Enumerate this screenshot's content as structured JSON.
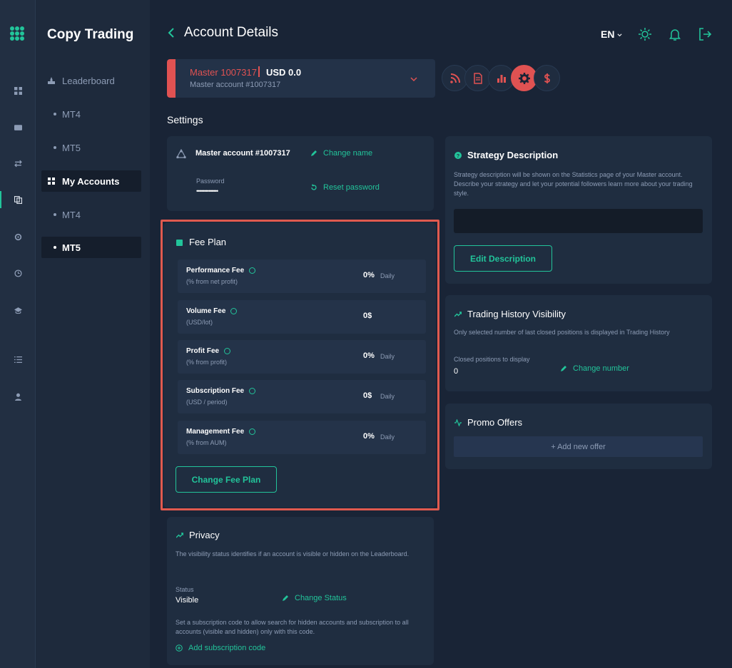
{
  "app": {
    "brand": "Copy Trading"
  },
  "header": {
    "title": "Account Details",
    "language": "EN"
  },
  "sidebar": {
    "items": [
      {
        "label": "Leaderboard"
      },
      {
        "label": "MT4"
      },
      {
        "label": "MT5"
      },
      {
        "label": "My Accounts"
      },
      {
        "label": "MT4"
      },
      {
        "label": "MT5"
      }
    ]
  },
  "account": {
    "name": "Master 1007317",
    "balance": "USD 0.0",
    "subtitle": "Master account #1007317"
  },
  "settings": {
    "label": "Settings",
    "account_card": {
      "name": "Master account #1007317",
      "change_name": "Change name",
      "password_label": "Password",
      "password_mask": "••••••••••••••",
      "reset_password": "Reset password"
    }
  },
  "fee_plan": {
    "title": "Fee Plan",
    "rows": [
      {
        "name": "Performance Fee",
        "unit": "(% from net profit)",
        "value": "0%",
        "period": "Daily"
      },
      {
        "name": "Volume Fee",
        "unit": "(USD/lot)",
        "value": "0$",
        "period": ""
      },
      {
        "name": "Profit Fee",
        "unit": "(% from profit)",
        "value": "0%",
        "period": "Daily"
      },
      {
        "name": "Subscription Fee",
        "unit": "(USD / period)",
        "value": "0$",
        "period": "Daily"
      },
      {
        "name": "Management Fee",
        "unit": "(% from AUM)",
        "value": "0%",
        "period": "Daily"
      }
    ],
    "button": "Change Fee Plan"
  },
  "privacy": {
    "title": "Privacy",
    "description": "The visibility status identifies if an account is visible or hidden on the Leaderboard.",
    "status_label": "Status",
    "status_value": "Visible",
    "change_status": "Change Status",
    "code_description": "Set a subscription code to allow search for hidden accounts and subscription to all accounts (visible and hidden) only with this code.",
    "add_code": "Add subscription code"
  },
  "strategy": {
    "title": "Strategy Description",
    "description": "Strategy description will be shown on the Statistics page of your Master account. Describe your strategy and let your potential followers learn more about your trading style.",
    "button": "Edit Description"
  },
  "history": {
    "title": "Trading History Visibility",
    "description": "Only selected number of last closed positions is displayed in Trading History",
    "label": "Closed positions to display",
    "value": "0",
    "change": "Change number"
  },
  "promo": {
    "title": "Promo Offers",
    "add": "+ Add new offer"
  },
  "colors": {
    "accent": "#22c49a",
    "danger": "#e05252",
    "background": "#192436",
    "card": "#1f2d40"
  }
}
